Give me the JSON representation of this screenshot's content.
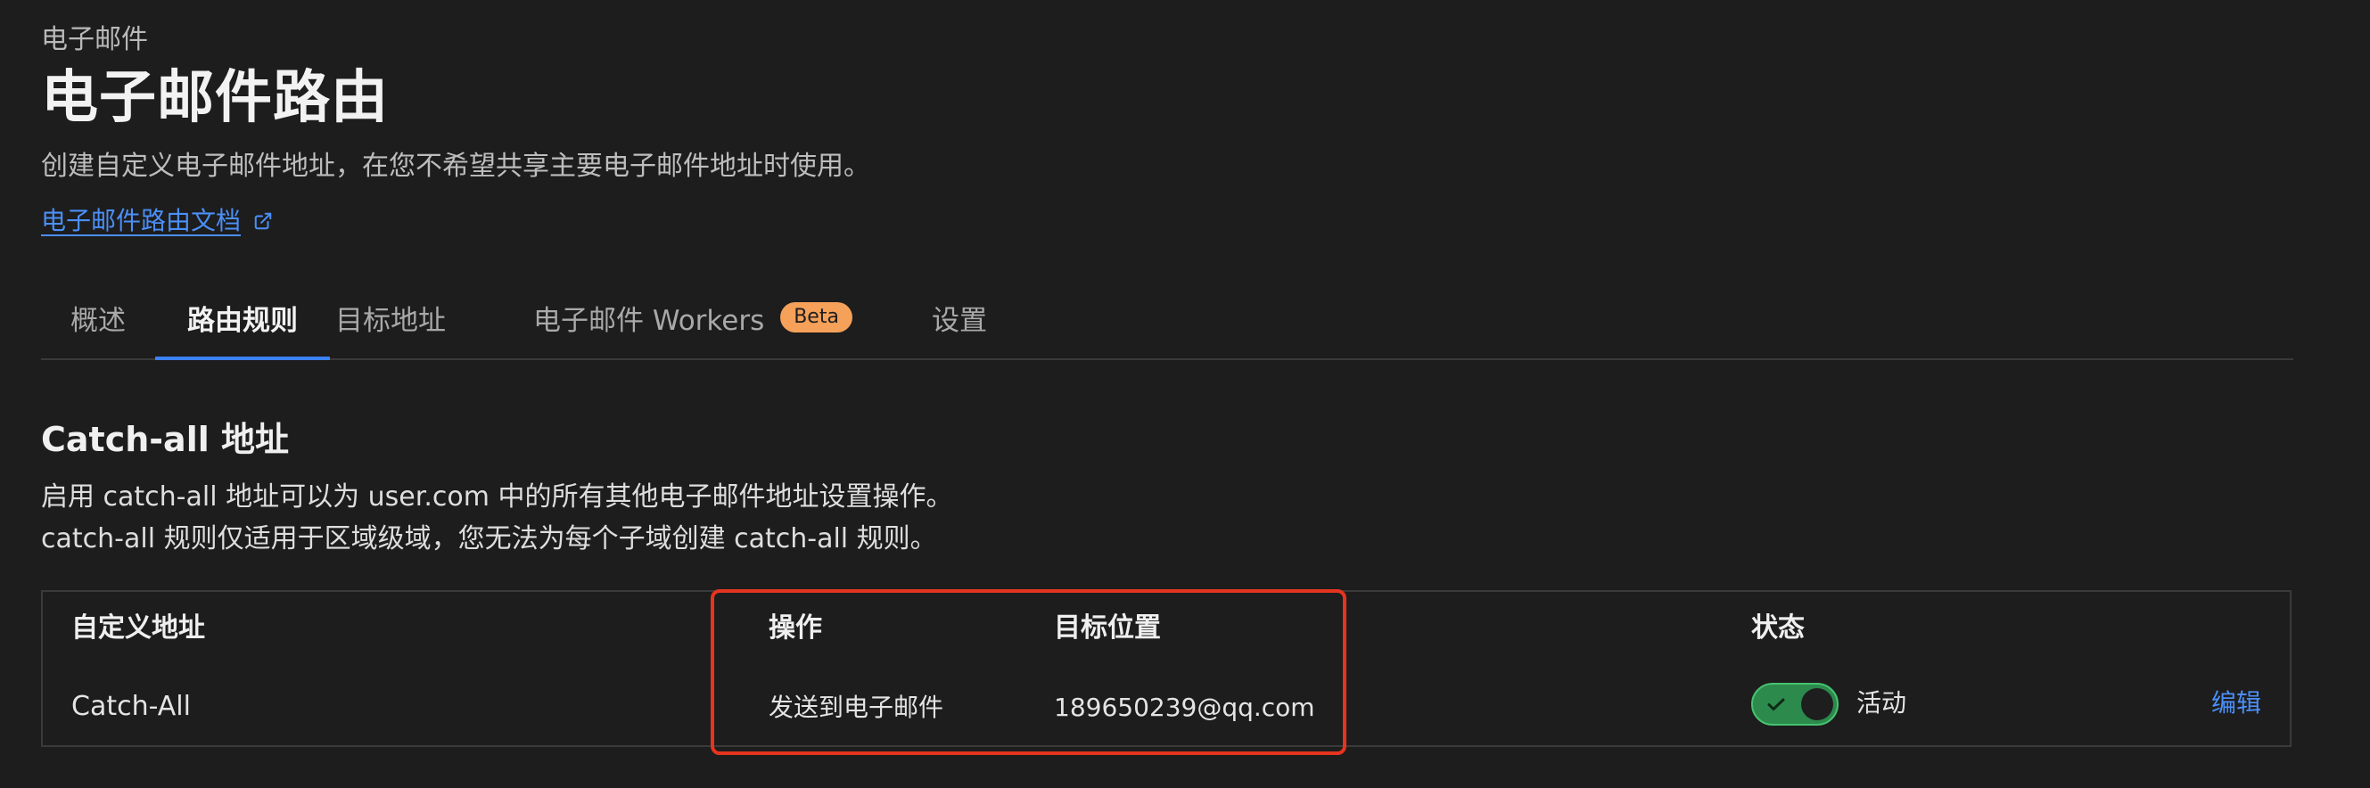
{
  "breadcrumb": "电子邮件",
  "title": "电子邮件路由",
  "subtitle": "创建自定义电子邮件地址，在您不希望共享主要电子邮件地址时使用。",
  "docs_link": {
    "label": "电子邮件路由文档",
    "icon": "external-link-icon"
  },
  "tabs": [
    {
      "label": "概述",
      "active": false
    },
    {
      "label": "路由规则",
      "active": true
    },
    {
      "label": "目标地址",
      "active": false
    },
    {
      "label": "电子邮件 Workers",
      "badge": "Beta",
      "active": false
    },
    {
      "label": "设置",
      "active": false
    }
  ],
  "section": {
    "title": "Catch-all 地址",
    "desc_line1": "启用 catch-all 地址可以为 user.com 中的所有其他电子邮件地址设置操作。",
    "desc_line2": "catch-all 规则仅适用于区域级域，您无法为每个子域创建 catch-all 规则。"
  },
  "table": {
    "headers": {
      "custom_address": "自定义地址",
      "action": "操作",
      "destination": "目标位置",
      "status": "状态"
    },
    "row": {
      "custom_address": "Catch-All",
      "action": "发送到电子邮件",
      "destination": "189650239@qq.com",
      "status": "活动",
      "status_enabled": true,
      "edit": "编辑"
    }
  },
  "colors": {
    "background": "#1d1d1d",
    "accent": "#3b82f6",
    "link": "#4b8ff7",
    "badge": "#f5a15a",
    "toggle_on": "#2b8a4c",
    "highlight": "#e5341f"
  }
}
